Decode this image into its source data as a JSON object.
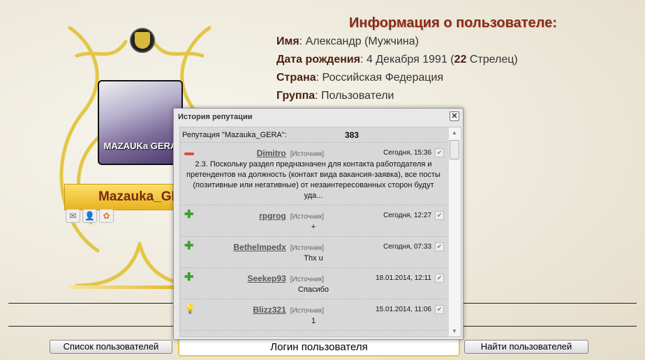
{
  "profile": {
    "username": "Mazauka_GERA",
    "avatar_text": "MAZAUKa GERA",
    "icons": [
      "mail-icon",
      "user-icon",
      "icq-icon"
    ]
  },
  "info": {
    "title": "Информация о пользователе:",
    "rows": [
      {
        "label": "Имя",
        "value": ": Александр (Мужчина)"
      },
      {
        "label": "Дата рождения",
        "value": ": 4 Декабря 1991 (",
        "bold": "22",
        "rest": " Стрелец)"
      },
      {
        "label": "Страна",
        "value": ": Российская Федерация"
      },
      {
        "label": "Группа",
        "value": ": Пользователи"
      }
    ]
  },
  "dialog": {
    "title": "История репутации",
    "close": "✕",
    "rep_label": "Репутация \"Mazauka_GERA\":",
    "rep_value": "383",
    "entries": [
      {
        "type": "minus",
        "user": "Dimitro",
        "source": "[Источник]",
        "date": "Сегодня, 15:36",
        "text": "2.3. Поскольку раздел предназначен для контакта работодателя и претендентов на должность (контакт вида вакансия-заявка), все посты (позитивные или негативные) от незаинтересованных сторон будут уда..."
      },
      {
        "type": "plus",
        "user": "rpgrog",
        "source": "[Источник]",
        "date": "Сегодня, 12:27",
        "text": "+"
      },
      {
        "type": "plus",
        "user": "Bethelmpedx",
        "source": "[Источник]",
        "date": "Сегодня, 07:33",
        "text": "Thx u"
      },
      {
        "type": "plus",
        "user": "Seekep93",
        "source": "[Источник]",
        "date": "18.01.2014, 12:11",
        "text": "Спасибо"
      },
      {
        "type": "neutral",
        "user": "Blizz321",
        "source": "[Источник]",
        "date": "15.01.2014, 11:06",
        "text": "1"
      }
    ]
  },
  "footer": {
    "user_list": "Список пользователей",
    "login_placeholder": "Логин пользователя",
    "find_users": "Найти пользователей"
  }
}
